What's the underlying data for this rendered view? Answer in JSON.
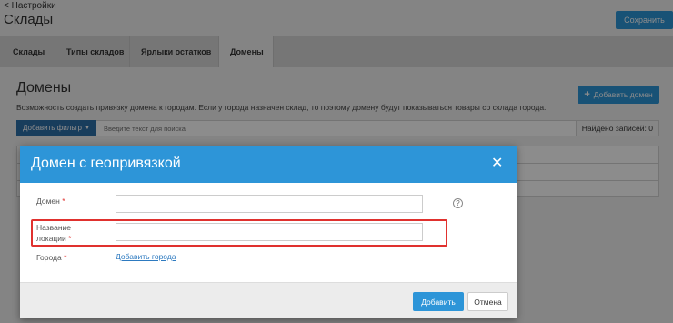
{
  "header": {
    "back_link": "< Настройки",
    "title": "Склады",
    "save_label": "Сохранить"
  },
  "tabs": [
    {
      "label": "Склады",
      "active": false
    },
    {
      "label": "Типы складов",
      "active": false
    },
    {
      "label": "Ярлыки остатков",
      "active": false
    },
    {
      "label": "Домены",
      "active": true
    }
  ],
  "section": {
    "title": "Домены",
    "description": "Возможность создать привязку домена к городам. Если у города назначен склад, то поэтому домену будут показываться товары со склада города.",
    "add_domain_label": "Добавить домен",
    "filter_label": "Добавить фильтр",
    "search_placeholder": "Введите текст для поиска",
    "found_text": "Найдено записей: 0"
  },
  "modal": {
    "title": "Домен с геопривязкой",
    "close_glyph": "✕",
    "fields": {
      "domain_label": "Домен",
      "domain_value": "",
      "location_label_line1": "Название",
      "location_label_line2": "локации",
      "location_value": "",
      "cities_label": "Города",
      "required_mark": "*"
    },
    "help_glyph": "?",
    "add_cities_link": "Добавить города",
    "add_button": "Добавить",
    "cancel_button": "Отмена"
  },
  "colors": {
    "accent": "#2d95d8",
    "required": "#e0312e",
    "highlight": "#e0312e"
  }
}
